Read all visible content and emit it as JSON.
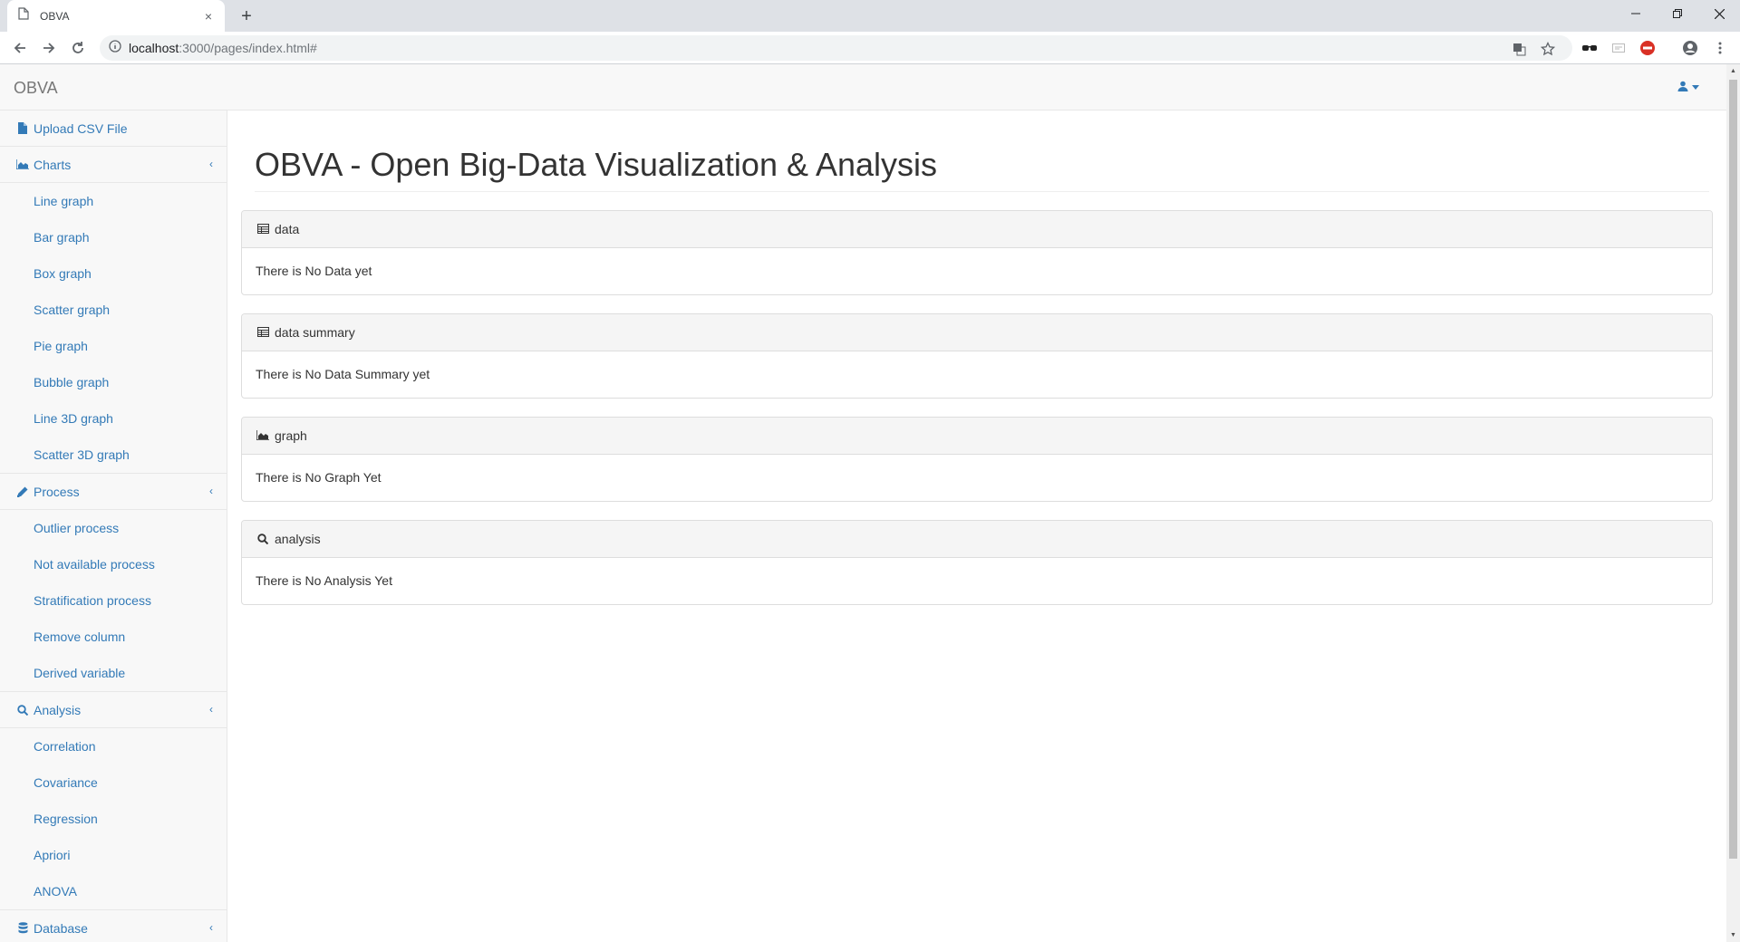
{
  "browser": {
    "tab_title": "OBVA",
    "tab_close": "×",
    "new_tab": "+",
    "url_host": "localhost",
    "url_rest": ":3000/pages/index.html#"
  },
  "app": {
    "brand": "OBVA",
    "page_title": "OBVA - Open Big-Data Visualization & Analysis",
    "accent_color": "#337ab7"
  },
  "sidebar": {
    "upload": "Upload CSV File",
    "charts": {
      "label": "Charts",
      "items": [
        "Line graph",
        "Bar graph",
        "Box graph",
        "Scatter graph",
        "Pie graph",
        "Bubble graph",
        "Line 3D graph",
        "Scatter 3D graph"
      ]
    },
    "process": {
      "label": "Process",
      "items": [
        "Outlier process",
        "Not available process",
        "Stratification process",
        "Remove column",
        "Derived variable"
      ]
    },
    "analysis": {
      "label": "Analysis",
      "items": [
        "Correlation",
        "Covariance",
        "Regression",
        "Apriori",
        "ANOVA"
      ]
    },
    "database": {
      "label": "Database"
    },
    "chevron": "‹"
  },
  "panels": [
    {
      "heading": "data",
      "body": "There is No Data yet",
      "icon": "table-icon"
    },
    {
      "heading": "data summary",
      "body": "There is No Data Summary yet",
      "icon": "table-icon"
    },
    {
      "heading": "graph",
      "body": "There is No Graph Yet",
      "icon": "area-chart-icon"
    },
    {
      "heading": "analysis",
      "body": "There is No Analysis Yet",
      "icon": "search-icon"
    }
  ]
}
